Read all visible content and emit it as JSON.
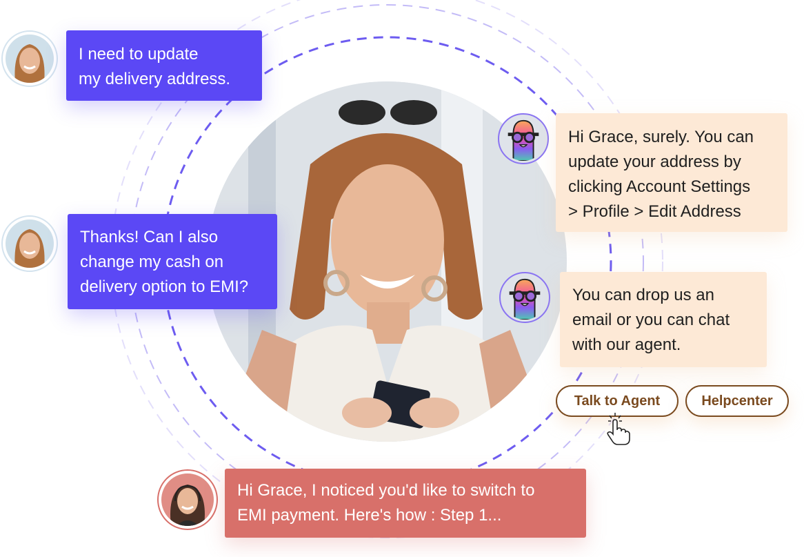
{
  "colors": {
    "user_bubble": "#5b48f5",
    "bot_bubble": "#fde9d6",
    "agent_bubble": "#d8706a",
    "button_text": "#7a4a1f",
    "ring": "#6d5cf0"
  },
  "conversation": {
    "messages": [
      {
        "sender": "user",
        "avatar": "customer-avatar",
        "lines": [
          "I need to update",
          "my delivery address."
        ]
      },
      {
        "sender": "bot",
        "avatar": "bot-avatar",
        "lines": [
          "Hi Grace, surely. You can",
          "update your address by",
          "clicking Account Settings",
          "> Profile > Edit Address"
        ]
      },
      {
        "sender": "user",
        "avatar": "customer-avatar",
        "lines": [
          "Thanks! Can I also",
          "change my cash on",
          "delivery option to EMI?"
        ]
      },
      {
        "sender": "bot",
        "avatar": "bot-avatar",
        "lines": [
          "You can drop us an",
          "email or you can chat",
          "with our agent."
        ]
      },
      {
        "sender": "agent",
        "avatar": "agent-avatar",
        "lines": [
          "Hi Grace, I noticed you'd like to switch to",
          "EMI payment. Here's how : Step 1..."
        ]
      }
    ],
    "quick_replies": [
      {
        "label": "Talk to Agent"
      },
      {
        "label": "Helpcenter"
      }
    ]
  },
  "icons": {
    "cursor": "hand-pointer-icon"
  }
}
